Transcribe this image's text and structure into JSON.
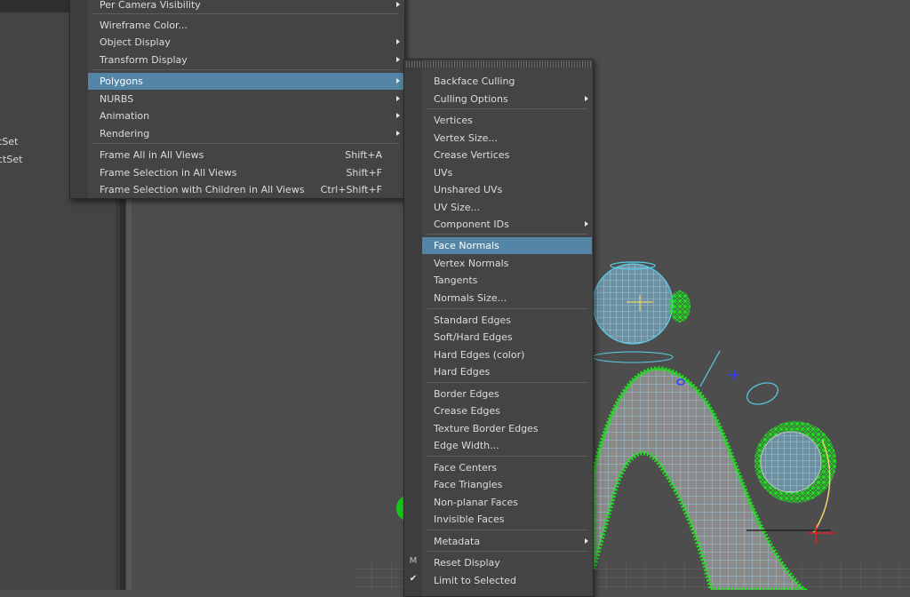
{
  "outliner": {
    "items": [
      "tSet",
      "ctSet"
    ]
  },
  "display_menu": {
    "items": [
      {
        "label": "Per Camera Visibility",
        "submenu": true
      },
      {
        "label": "Wireframe Color...",
        "submenu": false
      },
      {
        "label": "Object Display",
        "submenu": true
      },
      {
        "label": "Transform Display",
        "submenu": true
      },
      {
        "label": "Polygons",
        "submenu": true,
        "highlighted": true
      },
      {
        "label": "NURBS",
        "submenu": true
      },
      {
        "label": "Animation",
        "submenu": true
      },
      {
        "label": "Rendering",
        "submenu": true
      },
      {
        "label": "Frame All in All Views",
        "shortcut": "Shift+A"
      },
      {
        "label": "Frame Selection in All Views",
        "shortcut": "Shift+F"
      },
      {
        "label": "Frame Selection with Children in All Views",
        "shortcut": "Ctrl+Shift+F"
      }
    ]
  },
  "polygons_menu": {
    "items": [
      {
        "label": "Backface Culling"
      },
      {
        "label": "Culling Options",
        "submenu": true
      },
      {
        "label": "Vertices"
      },
      {
        "label": "Vertex Size..."
      },
      {
        "label": "Crease Vertices"
      },
      {
        "label": "UVs"
      },
      {
        "label": "Unshared UVs"
      },
      {
        "label": "UV Size..."
      },
      {
        "label": "Component IDs",
        "submenu": true
      },
      {
        "label": "Face Normals",
        "highlighted": true
      },
      {
        "label": "Vertex Normals"
      },
      {
        "label": "Tangents"
      },
      {
        "label": "Normals Size..."
      },
      {
        "label": "Standard Edges"
      },
      {
        "label": "Soft/Hard Edges"
      },
      {
        "label": "Hard Edges (color)"
      },
      {
        "label": "Hard Edges"
      },
      {
        "label": "Border Edges"
      },
      {
        "label": "Crease Edges"
      },
      {
        "label": "Texture Border Edges"
      },
      {
        "label": "Edge Width..."
      },
      {
        "label": "Face Centers"
      },
      {
        "label": "Face Triangles"
      },
      {
        "label": "Non-planar Faces"
      },
      {
        "label": "Invisible Faces"
      },
      {
        "label": "Metadata",
        "submenu": true
      },
      {
        "label": "Reset Display",
        "gutter_icon": "m-icon"
      },
      {
        "label": "Limit to Selected",
        "gutter_icon": "checkmark-icon",
        "checked": true
      }
    ],
    "gutter_glyphs": {
      "m": "M",
      "check": "✔"
    }
  },
  "colors": {
    "highlight": "#5285a6",
    "menu_bg": "#444444",
    "viewport_bg": "#4d4d4d",
    "wireframe": "#5ad0ea",
    "normals": "#18d818",
    "mesh": "#8a8a8a"
  }
}
